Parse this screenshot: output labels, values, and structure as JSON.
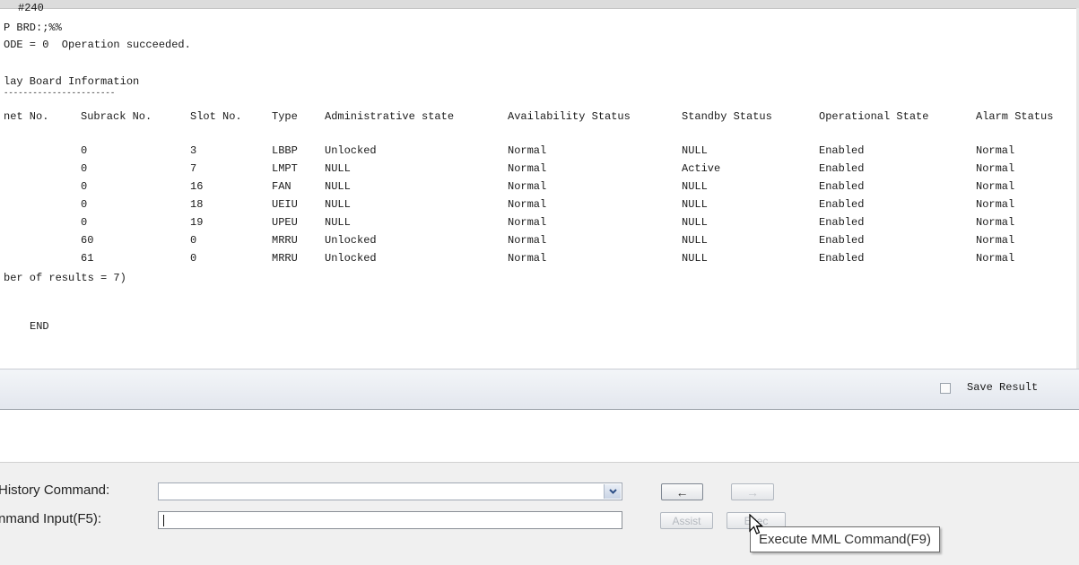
{
  "output": {
    "lines": {
      "l1": "#240",
      "l2": "P BRD:;%%",
      "l3": "ODE = 0  Operation succeeded.",
      "l4": "lay Board Information",
      "l5": "-----------------------"
    },
    "headers": [
      "net No.",
      "Subrack No.",
      "Slot No.",
      "Type",
      "Administrative state",
      "Availability Status",
      "Standby Status",
      "Operational State",
      "Alarm Status"
    ],
    "rows": [
      [
        "",
        "0",
        "3",
        "LBBP",
        "Unlocked",
        "Normal",
        "NULL",
        "Enabled",
        "Normal"
      ],
      [
        "",
        "0",
        "7",
        "LMPT",
        "NULL",
        "Normal",
        "Active",
        "Enabled",
        "Normal"
      ],
      [
        "",
        "0",
        "16",
        "FAN",
        "NULL",
        "Normal",
        "NULL",
        "Enabled",
        "Normal"
      ],
      [
        "",
        "0",
        "18",
        "UEIU",
        "NULL",
        "Normal",
        "NULL",
        "Enabled",
        "Normal"
      ],
      [
        "",
        "0",
        "19",
        "UPEU",
        "NULL",
        "Normal",
        "NULL",
        "Enabled",
        "Normal"
      ],
      [
        "",
        "60",
        "0",
        "MRRU",
        "Unlocked",
        "Normal",
        "NULL",
        "Enabled",
        "Normal"
      ],
      [
        "",
        "61",
        "0",
        "MRRU",
        "Unlocked",
        "Normal",
        "NULL",
        "Enabled",
        "Normal"
      ]
    ],
    "result_count": "ber of results = 7)",
    "end_label": "END"
  },
  "result_bar": {
    "save_result_label": "Save Result",
    "save_result_checked": false
  },
  "command_panel": {
    "history_label": "History Command:",
    "history_value": "",
    "input_label": "nmand Input(F5):",
    "input_value": "",
    "prev_icon": "left-arrow-icon",
    "next_icon": "right-arrow-icon",
    "assist_label": "Assist",
    "exec_label": "Exec",
    "tooltip": "Execute MML Command(F9)"
  }
}
